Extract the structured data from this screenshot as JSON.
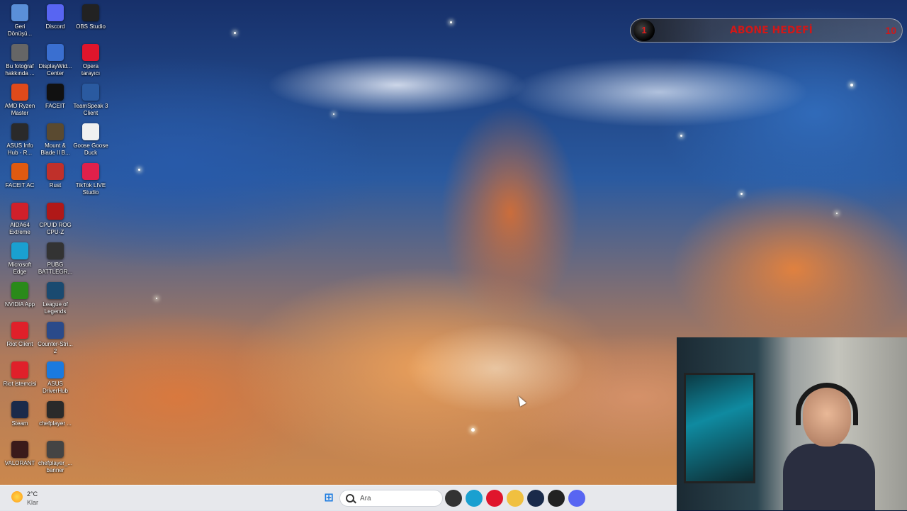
{
  "overlay": {
    "title": "ABONE HEDEFİ",
    "current": "1",
    "goal": "10",
    "accent": "#d01818"
  },
  "desktop_icons": [
    {
      "label": "Geri Dönüşü...",
      "icon": "recycle-bin-icon",
      "color": "#5a8fd8"
    },
    {
      "label": "Discord",
      "icon": "discord-icon",
      "color": "#5865f2"
    },
    {
      "label": "OBS Studio",
      "icon": "obs-icon",
      "color": "#222222"
    },
    {
      "label": "Bu fotoğraf hakkında ...",
      "icon": "info-icon",
      "color": "#666666"
    },
    {
      "label": "DisplayWid... Center",
      "icon": "display-widget-icon",
      "color": "#3a6fd0"
    },
    {
      "label": "Opera tarayıcı",
      "icon": "opera-icon",
      "color": "#e0152c"
    },
    {
      "label": "AMD Ryzen Master",
      "icon": "amd-icon",
      "color": "#e04a1a"
    },
    {
      "label": "FACEIT",
      "icon": "faceit-icon",
      "color": "#111111"
    },
    {
      "label": "TeamSpeak 3 Client",
      "icon": "teamspeak-icon",
      "color": "#2a5aa0"
    },
    {
      "label": "ASUS Info Hub - R...",
      "icon": "asus-info-icon",
      "color": "#2a2a2a"
    },
    {
      "label": "Mount & Blade II B...",
      "icon": "mount-blade-icon",
      "color": "#5a4a30"
    },
    {
      "label": "Goose Goose Duck",
      "icon": "goose-icon",
      "color": "#f0f0f0"
    },
    {
      "label": "FACEIT AC",
      "icon": "faceit-ac-icon",
      "color": "#e05a10"
    },
    {
      "label": "Rust",
      "icon": "rust-icon",
      "color": "#c0302a"
    },
    {
      "label": "TikTok LIVE Studio",
      "icon": "tiktok-icon",
      "color": "#e0204a"
    },
    {
      "label": "AIDA64 Extreme",
      "icon": "aida64-icon",
      "color": "#d0202a"
    },
    {
      "label": "CPUID ROG CPU-Z",
      "icon": "cpuz-icon",
      "color": "#b01818"
    },
    null,
    {
      "label": "Microsoft Edge",
      "icon": "edge-icon",
      "color": "#1aa0d0"
    },
    {
      "label": "PUBG BATTLEGR...",
      "icon": "pubg-icon",
      "color": "#333333"
    },
    null,
    {
      "label": "NVIDIA App",
      "icon": "nvidia-icon",
      "color": "#2a8a1a"
    },
    {
      "label": "League of Legends",
      "icon": "lol-icon",
      "color": "#1a4a70"
    },
    null,
    {
      "label": "Riot Client",
      "icon": "riot-client-icon",
      "color": "#e0202a"
    },
    {
      "label": "Counter-Stri... 2",
      "icon": "cs2-icon",
      "color": "#2a4a8a"
    },
    null,
    {
      "label": "Riot istemcisi",
      "icon": "riot-istemcisi-icon",
      "color": "#e0202a"
    },
    {
      "label": "ASUS DriverHub",
      "icon": "asus-driverhub-icon",
      "color": "#1a7ae0"
    },
    null,
    {
      "label": "Steam",
      "icon": "steam-icon",
      "color": "#1a2a4a"
    },
    {
      "label": "chefplayer ...",
      "icon": "chefplayer-icon",
      "color": "#2a2a2a"
    },
    null,
    {
      "label": "VALORANT",
      "icon": "valorant-icon",
      "color": "#3a1a1a"
    },
    {
      "label": "chefplayer_... banner",
      "icon": "image-file-icon",
      "color": "#444444"
    },
    null
  ],
  "taskbar": {
    "weather": {
      "temp": "2°C",
      "condition": "Klar",
      "icon": "weather-icon"
    },
    "start_icon": "windows-start-icon",
    "search_placeholder": "Ara",
    "apps": [
      {
        "icon": "task-view-icon",
        "color": "#333333"
      },
      {
        "icon": "edge-icon",
        "color": "#1aa0d0"
      },
      {
        "icon": "opera-icon",
        "color": "#e0152c"
      },
      {
        "icon": "file-explorer-icon",
        "color": "#f0c040"
      },
      {
        "icon": "steam-icon",
        "color": "#1a2a4a"
      },
      {
        "icon": "obs-icon",
        "color": "#222222"
      },
      {
        "icon": "discord-icon",
        "color": "#5865f2"
      }
    ]
  }
}
